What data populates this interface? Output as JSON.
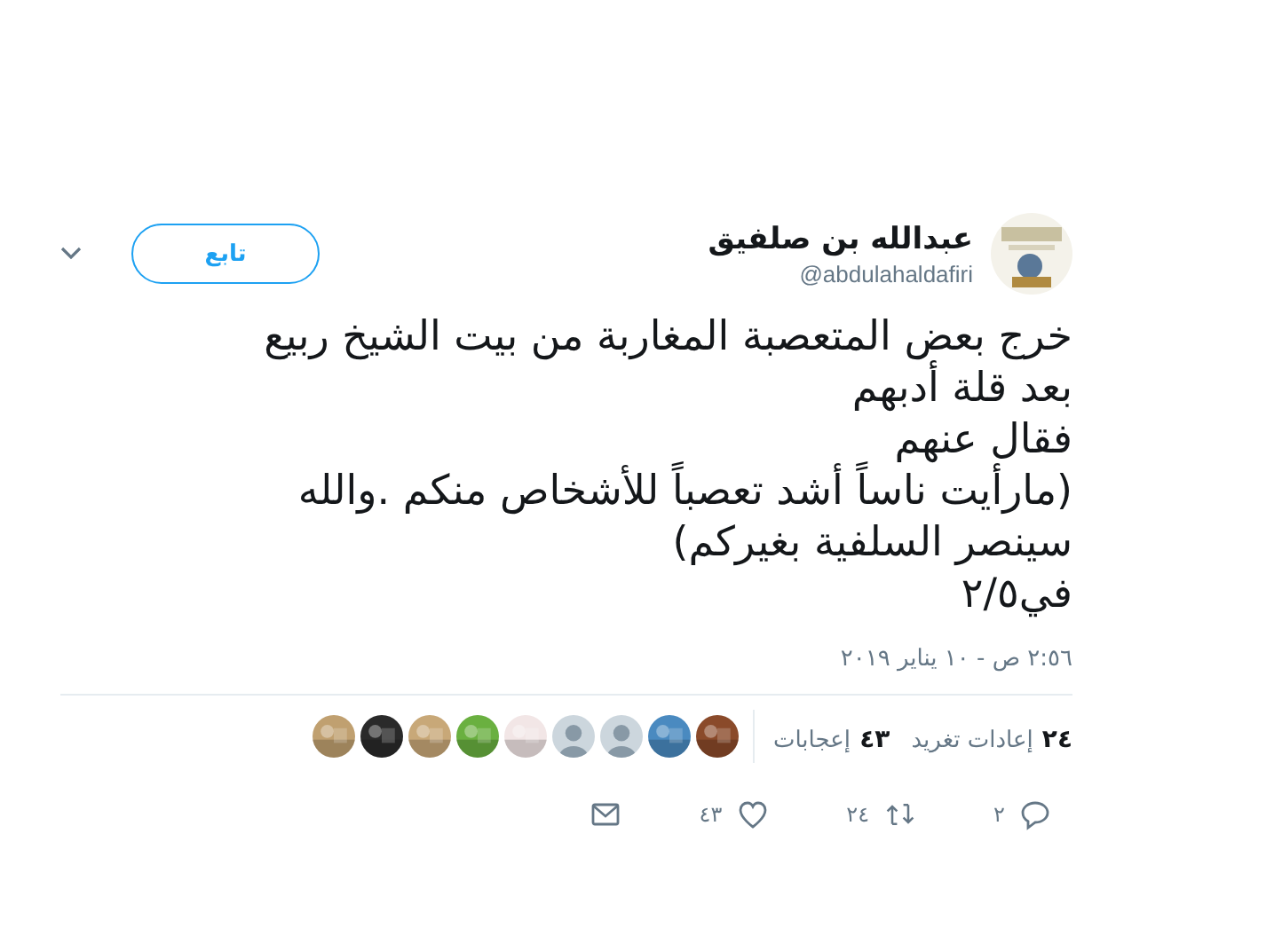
{
  "tweet": {
    "author": "عبدالله بن صلفيق",
    "handle": "@abdulahaldafiri",
    "follow_button": "تابع",
    "text_lines": [
      "خرج بعض المتعصبة المغاربة من بيت الشيخ ربيع",
      "بعد قلة أدبهم",
      "فقال عنهم",
      "(مارأيت ناساً أشد تعصباً للأشخاص منكم .والله",
      "سينصر السلفية بغيركم)",
      "في٢/٥"
    ],
    "timestamp": "٢:٥٦ ص - ١٠ يناير ٢٠١٩",
    "stats": [
      {
        "count": "٢٤",
        "label": "إعادات تغريد"
      },
      {
        "count": "٤٣",
        "label": "إعجابات"
      }
    ],
    "likers": [
      {
        "kind": "picture"
      },
      {
        "kind": "picture"
      },
      {
        "kind": "default"
      },
      {
        "kind": "default"
      },
      {
        "kind": "picture"
      },
      {
        "kind": "picture"
      },
      {
        "kind": "picture"
      },
      {
        "kind": "picture"
      },
      {
        "kind": "picture"
      }
    ],
    "actions": [
      {
        "kind": "reply",
        "count": "٢"
      },
      {
        "kind": "retweet",
        "count": "٢٤"
      },
      {
        "kind": "like",
        "count": "٤٣"
      },
      {
        "kind": "message"
      }
    ]
  }
}
